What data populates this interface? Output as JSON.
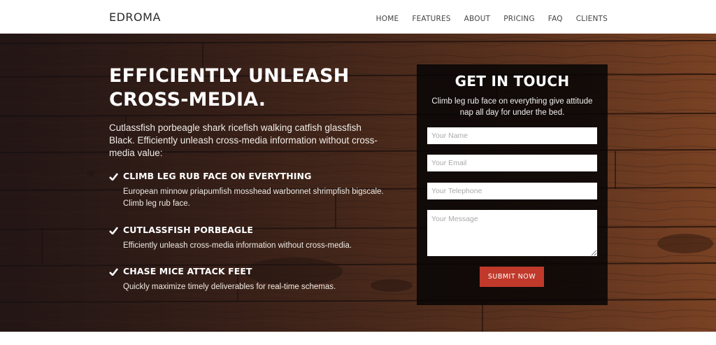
{
  "navbar": {
    "brand": "EDROMA",
    "items": [
      {
        "label": "HOME"
      },
      {
        "label": "FEATURES"
      },
      {
        "label": "ABOUT"
      },
      {
        "label": "PRICING"
      },
      {
        "label": "FAQ"
      },
      {
        "label": "CLIENTS"
      }
    ]
  },
  "hero": {
    "headline_line1": "EFFICIENTLY UNLEASH",
    "headline_line2": "CROSS-MEDIA.",
    "intro": "Cutlassfish porbeagle shark ricefish walking catfish glassfish Black. Efficiently unleash cross-media information without cross-media value:",
    "features": [
      {
        "title": "CLIMB LEG RUB FACE ON EVERYTHING",
        "desc": "European minnow priapumfish mosshead warbonnet shrimpfish bigscale. Climb leg rub face."
      },
      {
        "title": "CUTLASSFISH PORBEAGLE",
        "desc": "Efficiently unleash cross-media information without cross-media."
      },
      {
        "title": "CHASE MICE ATTACK FEET",
        "desc": "Quickly maximize timely deliverables for real-time schemas."
      }
    ]
  },
  "contact": {
    "title": "GET IN TOUCH",
    "subtitle": "Climb leg rub face on everything give attitude nap all day for under the bed.",
    "name_placeholder": "Your Name",
    "email_placeholder": "Your Email",
    "telephone_placeholder": "Your Telephone",
    "message_placeholder": "Your Message",
    "submit_label": "SUBMIT NOW"
  },
  "colors": {
    "accent": "#c0392b",
    "wood": "#6b3a1f",
    "panel": "#080606"
  }
}
